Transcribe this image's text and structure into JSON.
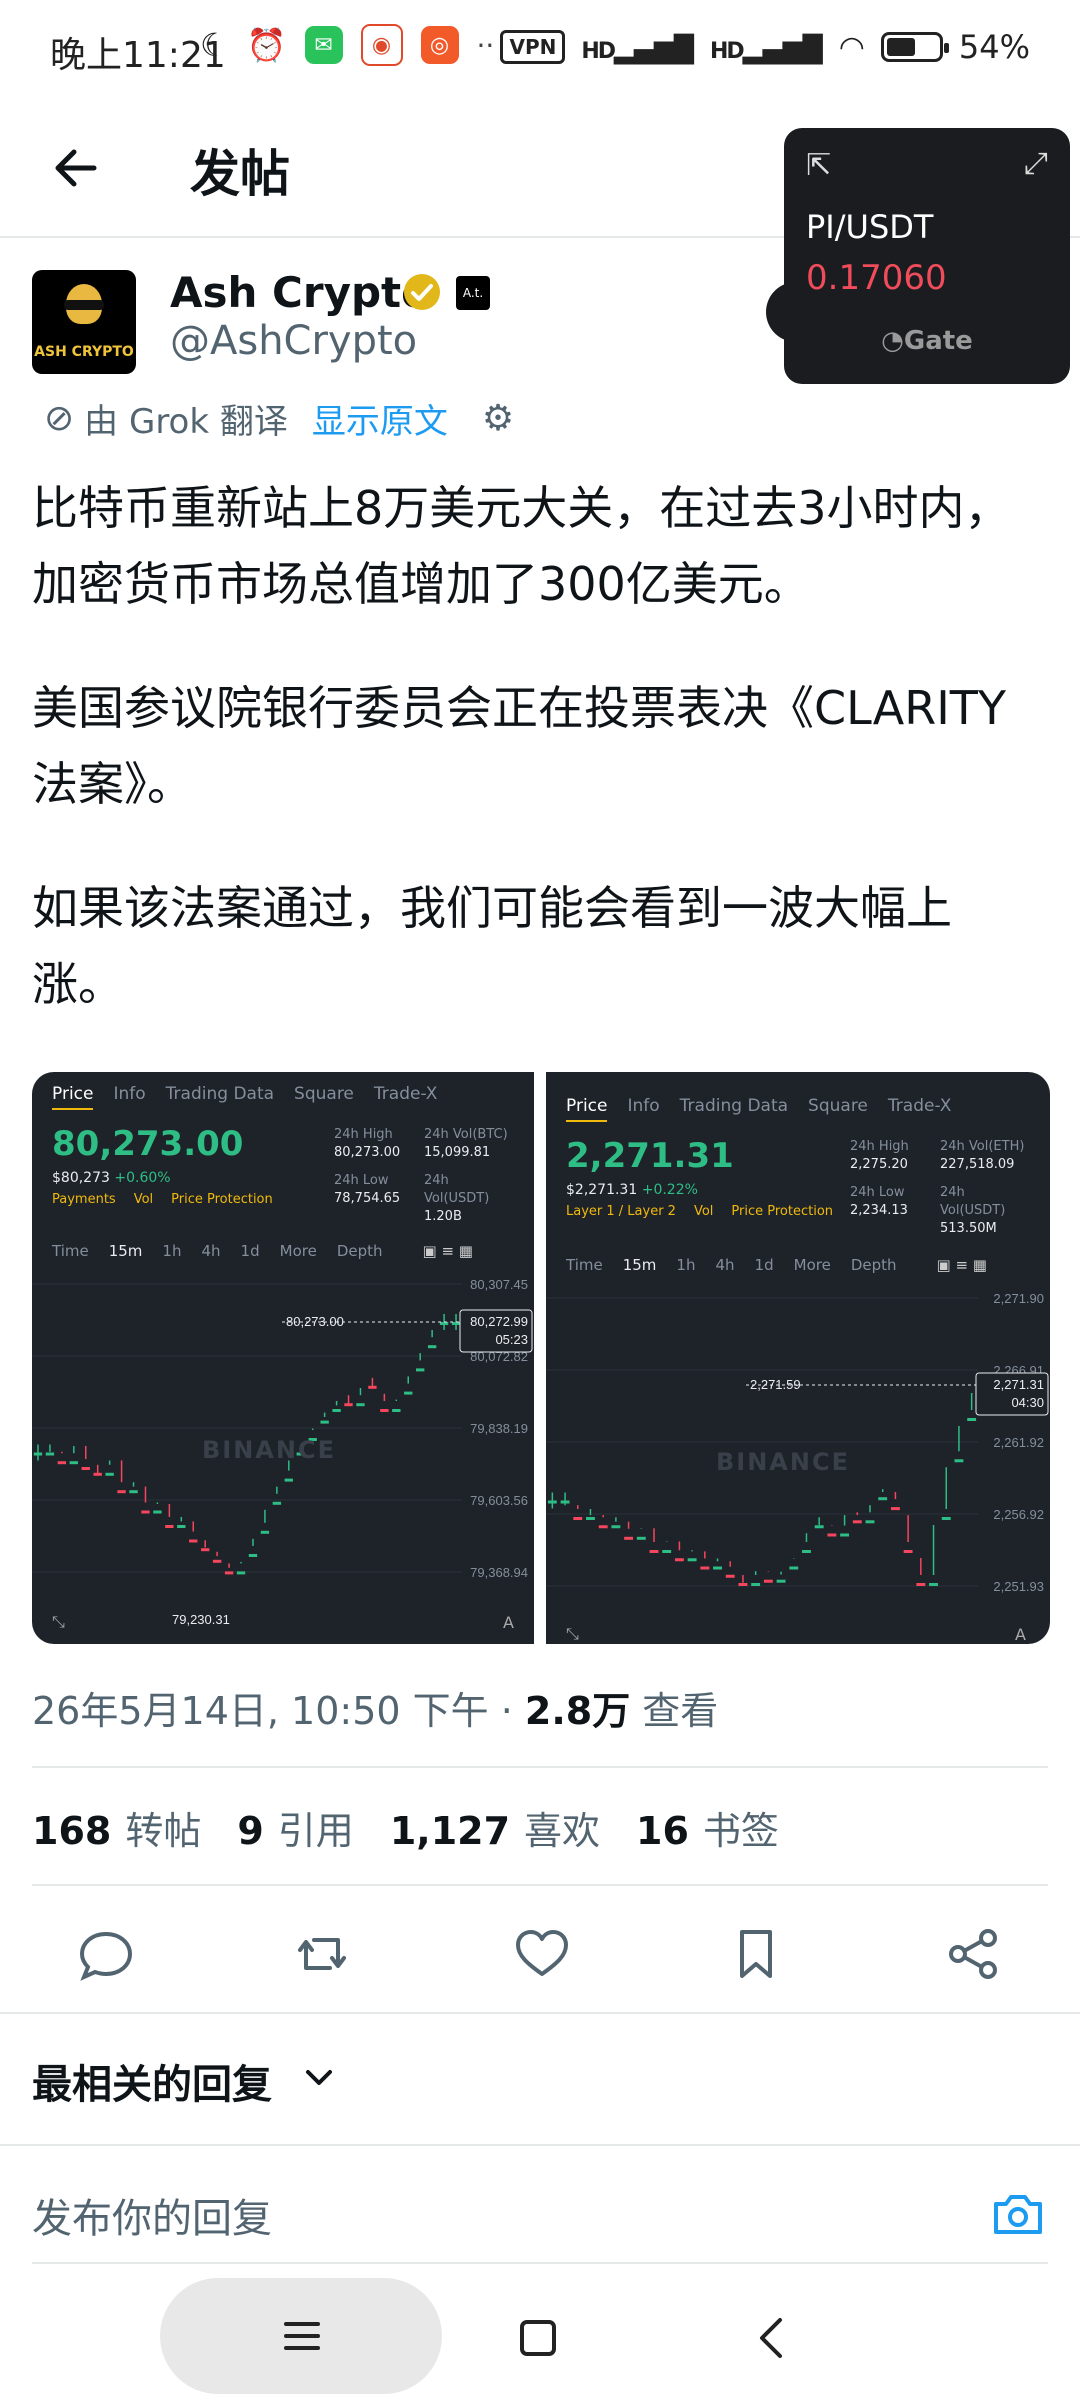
{
  "status_bar": {
    "time": "晚上11:21",
    "vpn": "VPN",
    "sig1": "HD",
    "sig2": "HD",
    "battery": "54%"
  },
  "header": {
    "title": "发帖"
  },
  "widget": {
    "pair": "PI/USDT",
    "price": "0.17060",
    "brand": "Gate"
  },
  "author": {
    "name": "Ash Crypto",
    "handle": "@AshCrypto",
    "avatar_text": "ASH CRYPTO"
  },
  "translate": {
    "by": "由 Grok 翻译",
    "show_original": "显示原文"
  },
  "post": {
    "p1": "比特币重新站上8万美元大关，在过去3小时内，加密货币市场总值增加了300亿美元。",
    "p2": "美国参议院银行委员会正在投票表决《CLARITY法案》。",
    "p3": "如果该法案通过，我们可能会看到一波大幅上涨。"
  },
  "image1": {
    "tabs": [
      "Price",
      "Info",
      "Trading Data",
      "Square",
      "Trade-X"
    ],
    "price": "80,273.00",
    "sub": "$80,273",
    "change": "+0.60%",
    "links": [
      "Payments",
      "Vol",
      "Price Protection"
    ],
    "high_label": "24h High",
    "high": "80,273.00",
    "vol1_label": "24h Vol(BTC)",
    "vol1": "15,099.81",
    "low_label": "24h Low",
    "low": "78,754.65",
    "vol2_label": "24h Vol(USDT)",
    "vol2": "1.20B",
    "tf": [
      "Time",
      "15m",
      "1h",
      "4h",
      "1d",
      "More",
      "Depth"
    ],
    "peak_label": "80,273.00",
    "low_mark": "79,230.31",
    "price_tag": "80,272.99",
    "countdown": "05:23",
    "y_ticks": [
      "80,307.45",
      "80,072.82",
      "79,838.19",
      "79,603.56",
      "79,368.94"
    ],
    "watermark": "BINANCE",
    "corner": "A"
  },
  "image2": {
    "tabs": [
      "Price",
      "Info",
      "Trading Data",
      "Square",
      "Trade-X"
    ],
    "price": "2,271.31",
    "sub": "$2,271.31",
    "change": "+0.22%",
    "links": [
      "Layer 1 / Layer 2",
      "Vol",
      "Price Protection"
    ],
    "high_label": "24h High",
    "high": "2,275.20",
    "vol1_label": "24h Vol(ETH)",
    "vol1": "227,518.09",
    "low_label": "24h Low",
    "low": "2,234.13",
    "vol2_label": "24h Vol(USDT)",
    "vol2": "513.50M",
    "tf": [
      "Time",
      "15m",
      "1h",
      "4h",
      "1d",
      "More",
      "Depth"
    ],
    "peak_label": "2,271.59",
    "price_tag": "2,271.31",
    "countdown": "04:30",
    "y_ticks": [
      "2,271.90",
      "2,266.91",
      "2,261.92",
      "2,256.92",
      "2,251.93"
    ],
    "watermark": "BINANCE",
    "corner": "A"
  },
  "meta": {
    "datetime": "26年5月14日, 10:50 下午 · ",
    "views": "2.8万",
    "views_label": " 查看"
  },
  "counts": [
    {
      "n": "168",
      "label": "转帖"
    },
    {
      "n": "9",
      "label": "引用"
    },
    {
      "n": "1,127",
      "label": "喜欢"
    },
    {
      "n": "16",
      "label": "书签"
    }
  ],
  "sort": {
    "label": "最相关的回复"
  },
  "reply": {
    "placeholder": "发布你的回复"
  },
  "colors": {
    "accent": "#1d9bf0",
    "up": "#2ebd85",
    "down": "#f6465d",
    "gold": "#f0b90b"
  }
}
